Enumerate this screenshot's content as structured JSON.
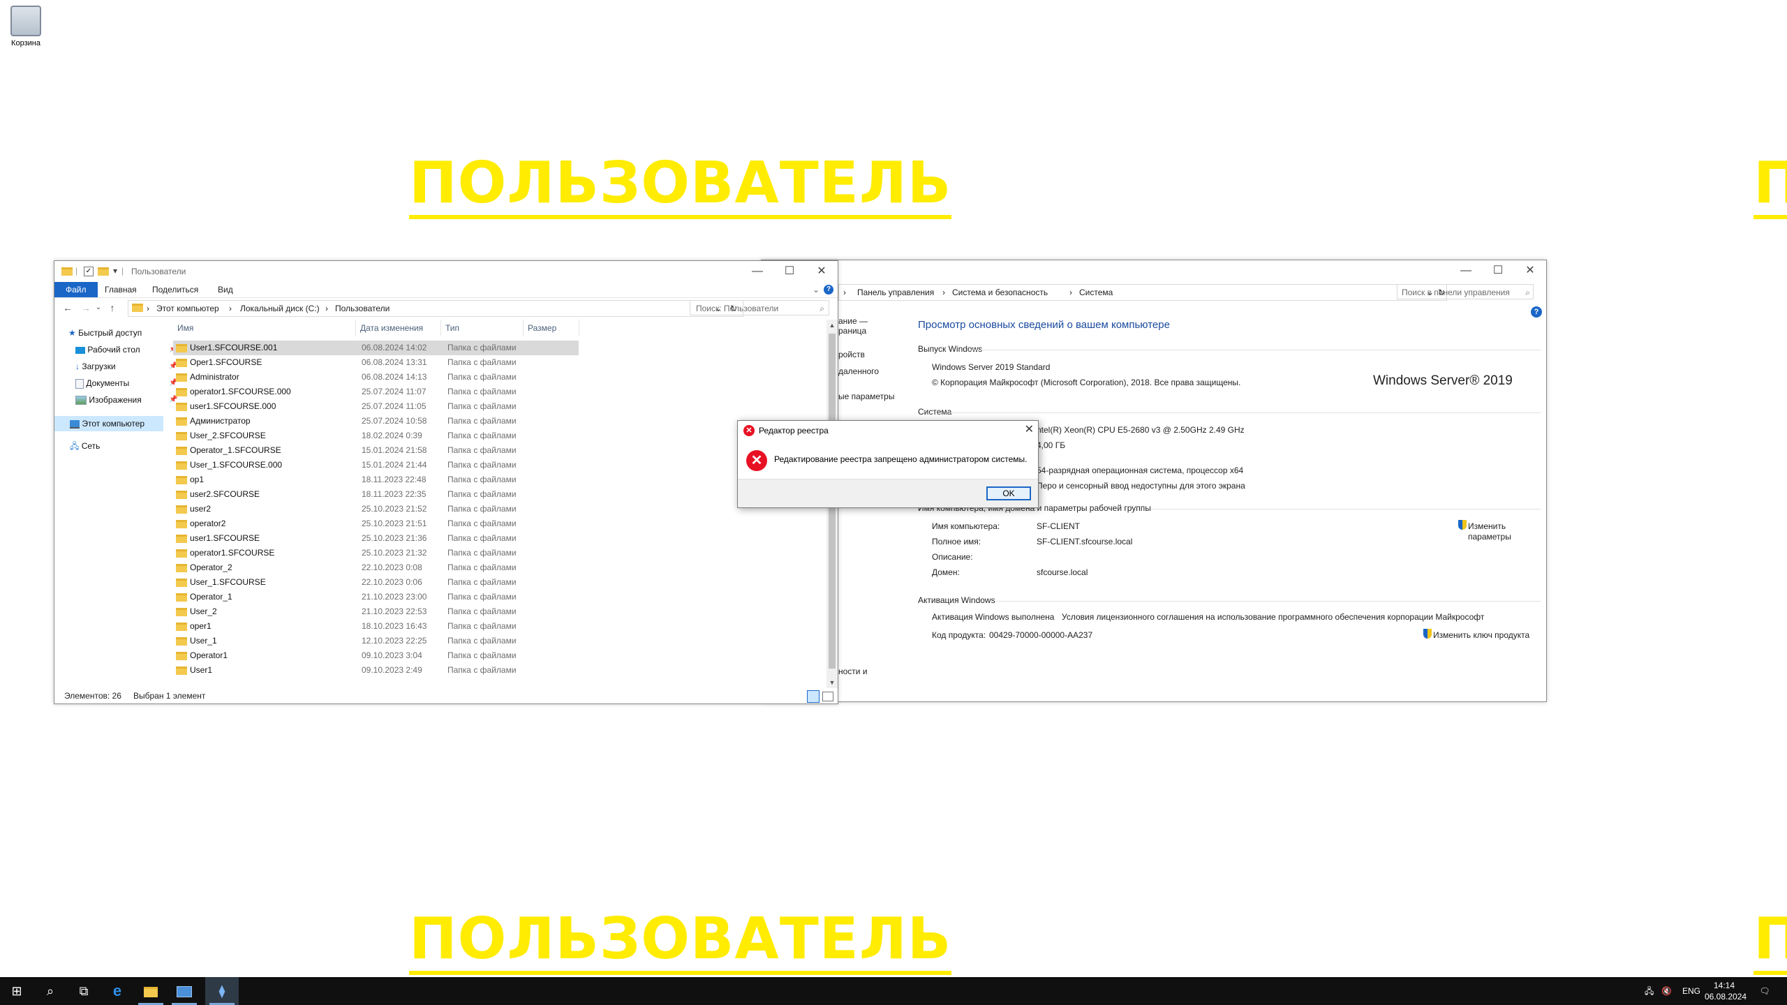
{
  "desktop": {
    "recycle_bin_label": "Корзина",
    "watermark_text": "ПОЛЬЗОВАТЕЛЬ",
    "watermark_cut": "П"
  },
  "explorer": {
    "title": "Пользователи",
    "ribbon_tabs": [
      "Файл",
      "Главная",
      "Поделиться",
      "Вид"
    ],
    "breadcrumb": [
      "Этот компьютер",
      "Локальный диск (C:)",
      "Пользователи"
    ],
    "search_placeholder": "Поиск: Пользователи",
    "nav": [
      {
        "label": "Быстрый доступ",
        "icon": "star-icon"
      },
      {
        "label": "Рабочий стол",
        "icon": "desktop-icon"
      },
      {
        "label": "Загрузки",
        "icon": "download-icon"
      },
      {
        "label": "Документы",
        "icon": "document-icon"
      },
      {
        "label": "Изображения",
        "icon": "image-icon"
      },
      {
        "label": "Этот компьютер",
        "icon": "computer-icon"
      },
      {
        "label": "Сеть",
        "icon": "network-icon"
      }
    ],
    "columns": [
      "Имя",
      "Дата изменения",
      "Тип",
      "Размер"
    ],
    "rows": [
      {
        "name": "User1.SFCOURSE.001",
        "date": "06.08.2024 14:02",
        "type": "Папка с файлами"
      },
      {
        "name": "Oper1.SFCOURSE",
        "date": "06.08.2024 13:31",
        "type": "Папка с файлами"
      },
      {
        "name": "Administrator",
        "date": "06.08.2024 14:13",
        "type": "Папка с файлами"
      },
      {
        "name": "operator1.SFCOURSE.000",
        "date": "25.07.2024 11:07",
        "type": "Папка с файлами"
      },
      {
        "name": "user1.SFCOURSE.000",
        "date": "25.07.2024 11:05",
        "type": "Папка с файлами"
      },
      {
        "name": "Администратор",
        "date": "25.07.2024 10:58",
        "type": "Папка с файлами"
      },
      {
        "name": "User_2.SFCOURSE",
        "date": "18.02.2024 0:39",
        "type": "Папка с файлами"
      },
      {
        "name": "Operator_1.SFCOURSE",
        "date": "15.01.2024 21:58",
        "type": "Папка с файлами"
      },
      {
        "name": "User_1.SFCOURSE.000",
        "date": "15.01.2024 21:44",
        "type": "Папка с файлами"
      },
      {
        "name": "op1",
        "date": "18.11.2023 22:48",
        "type": "Папка с файлами"
      },
      {
        "name": "user2.SFCOURSE",
        "date": "18.11.2023 22:35",
        "type": "Папка с файлами"
      },
      {
        "name": "user2",
        "date": "25.10.2023 21:52",
        "type": "Папка с файлами"
      },
      {
        "name": "operator2",
        "date": "25.10.2023 21:51",
        "type": "Папка с файлами"
      },
      {
        "name": "user1.SFCOURSE",
        "date": "25.10.2023 21:36",
        "type": "Папка с файлами"
      },
      {
        "name": "operator1.SFCOURSE",
        "date": "25.10.2023 21:32",
        "type": "Папка с файлами"
      },
      {
        "name": "Operator_2",
        "date": "22.10.2023 0:08",
        "type": "Папка с файлами"
      },
      {
        "name": "User_1.SFCOURSE",
        "date": "22.10.2023 0:06",
        "type": "Папка с файлами"
      },
      {
        "name": "Operator_1",
        "date": "21.10.2023 23:00",
        "type": "Папка с файлами"
      },
      {
        "name": "User_2",
        "date": "21.10.2023 22:53",
        "type": "Папка с файлами"
      },
      {
        "name": "oper1",
        "date": "18.10.2023 16:43",
        "type": "Папка с файлами"
      },
      {
        "name": "User_1",
        "date": "12.10.2023 22:25",
        "type": "Папка с файлами"
      },
      {
        "name": "Operator1",
        "date": "09.10.2023 3:04",
        "type": "Папка с файлами"
      },
      {
        "name": "User1",
        "date": "09.10.2023 2:49",
        "type": "Папка с файлами"
      }
    ],
    "status_count": "Элементов: 26",
    "status_selected": "Выбран 1 элемент"
  },
  "system": {
    "breadcrumb": [
      "Панель управления",
      "Система и безопасность",
      "Система"
    ],
    "search_placeholder": "Поиск в панели управления",
    "left_links": [
      "раница",
      "ание —",
      "ройств",
      "даленного",
      "ые параметры",
      "ности и"
    ],
    "heading": "Просмотр основных сведений о вашем компьютере",
    "edition_header": "Выпуск Windows",
    "edition": "Windows Server 2019 Standard",
    "copyright": "© Корпорация Майкрософт (Microsoft Corporation), 2018. Все права защищены.",
    "logo_text": "Windows Server® 2019",
    "system_header": "Система",
    "cpu": "ntel(R) Xeon(R) CPU E5-2680 v3 @ 2.50GHz   2.49 GHz",
    "ram": "4,00 ГБ",
    "os_type": "54-разрядная операционная система, процессор x64",
    "pen": "Перо и сенсорный ввод недоступны для этого экрана",
    "name_header": "Имя компьютера, имя домена и параметры рабочей группы",
    "computer_name_label": "Имя компьютера:",
    "computer_name": "SF-CLIENT",
    "full_name_label": "Полное имя:",
    "full_name": "SF-CLIENT.sfcourse.local",
    "description_label": "Описание:",
    "domain_label": "Домен:",
    "domain": "sfcourse.local",
    "change_settings": "Изменить параметры",
    "activation_header": "Активация Windows",
    "activation_status": "Активация Windows выполнена",
    "license_link": "Условия лицензионного соглашения на использование программного обеспечения корпорации Майкрософт",
    "product_key_label": "Код продукта:",
    "product_key": "00429-70000-00000-AA237",
    "change_key": "Изменить ключ продукта"
  },
  "dialog": {
    "title": "Редактор реестра",
    "message": "Редактирование реестра запрещено администратором системы.",
    "ok": "OK"
  },
  "taskbar": {
    "lang": "ENG",
    "time": "14:14",
    "date": "06.08.2024"
  },
  "colors": {
    "watermark": "#ffec00",
    "accent": "#1a66c7",
    "taskbar": "#101010",
    "error": "#e81123"
  }
}
